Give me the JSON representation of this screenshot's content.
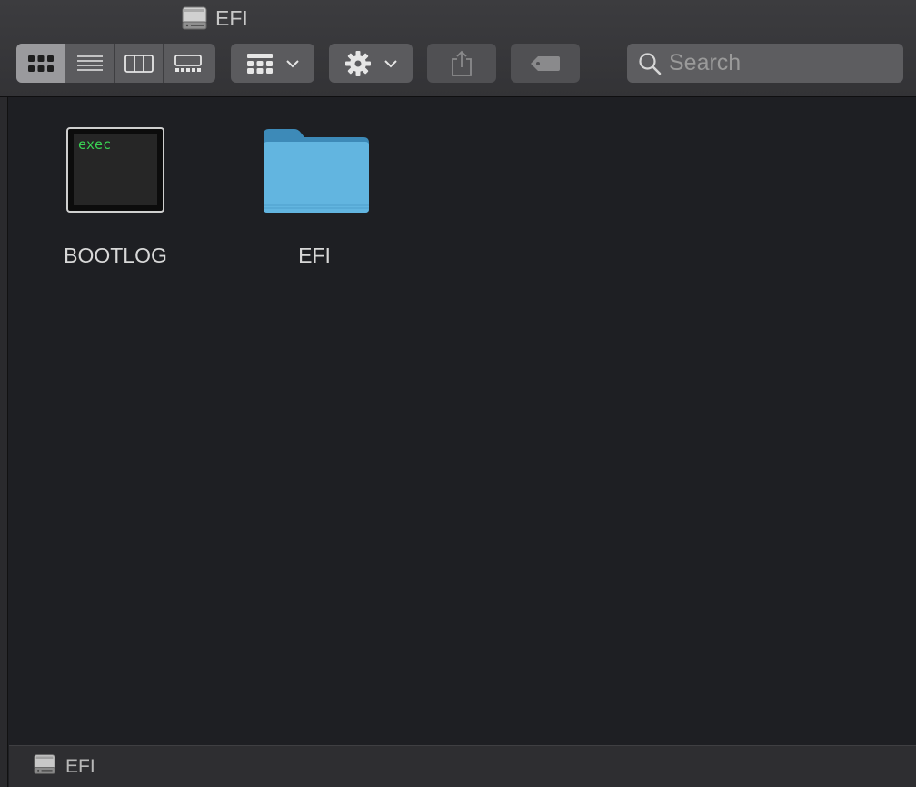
{
  "window": {
    "title": "EFI"
  },
  "toolbar": {
    "view_modes": [
      {
        "name": "icon-view",
        "icon": "grid-icon",
        "active": true
      },
      {
        "name": "list-view",
        "icon": "list-icon",
        "active": false
      },
      {
        "name": "column-view",
        "icon": "columns-icon",
        "active": false
      },
      {
        "name": "gallery-view",
        "icon": "gallery-icon",
        "active": false
      }
    ],
    "group_by_icon": "group-grid-icon",
    "action_icon": "gear-icon",
    "share_icon": "share-icon",
    "tag_icon": "tag-icon"
  },
  "search": {
    "placeholder": "Search",
    "value": ""
  },
  "files": [
    {
      "name": "BOOTLOG",
      "kind": "unix-executable",
      "icon_text": "exec"
    },
    {
      "name": "EFI",
      "kind": "folder"
    }
  ],
  "path_bar": {
    "label": "EFI"
  },
  "colors": {
    "folder": "#5fb3de",
    "exec_text": "#39d353",
    "background": "#1e1f23",
    "toolbar": "#38383b"
  }
}
